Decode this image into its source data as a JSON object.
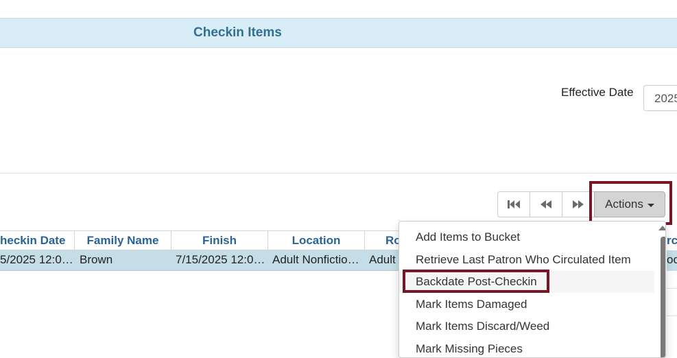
{
  "header": {
    "title": "Checkin Items"
  },
  "effective_date": {
    "label": "Effective Date",
    "value": "2025"
  },
  "pager": {
    "first_icon": "first-page-icon",
    "prev_icon": "previous-page-icon",
    "next_icon": "next-page-icon"
  },
  "actions": {
    "label": "Actions"
  },
  "grid": {
    "columns": [
      "heckin Date",
      "Family Name",
      "Finish",
      "Location",
      "Ro"
    ],
    "row": [
      "5/2025 12:0…",
      "Brown",
      "7/15/2025 12:0…",
      "Adult Nonfictio…",
      "Adult"
    ],
    "right_edge_header": "rc",
    "right_edge_value": "oo"
  },
  "menu": {
    "items": [
      "Add Items to Bucket",
      "Retrieve Last Patron Who Circulated Item",
      "Backdate Post-Checkin",
      "Mark Items Damaged",
      "Mark Items Discard/Weed",
      "Mark Missing Pieces"
    ],
    "active_index": 2
  },
  "colors": {
    "header_bg": "#d9edf7",
    "header_text": "#31708f",
    "highlight_border": "#7a1526",
    "row_selected": "#c4dde6",
    "column_header_text": "#2a6496"
  }
}
